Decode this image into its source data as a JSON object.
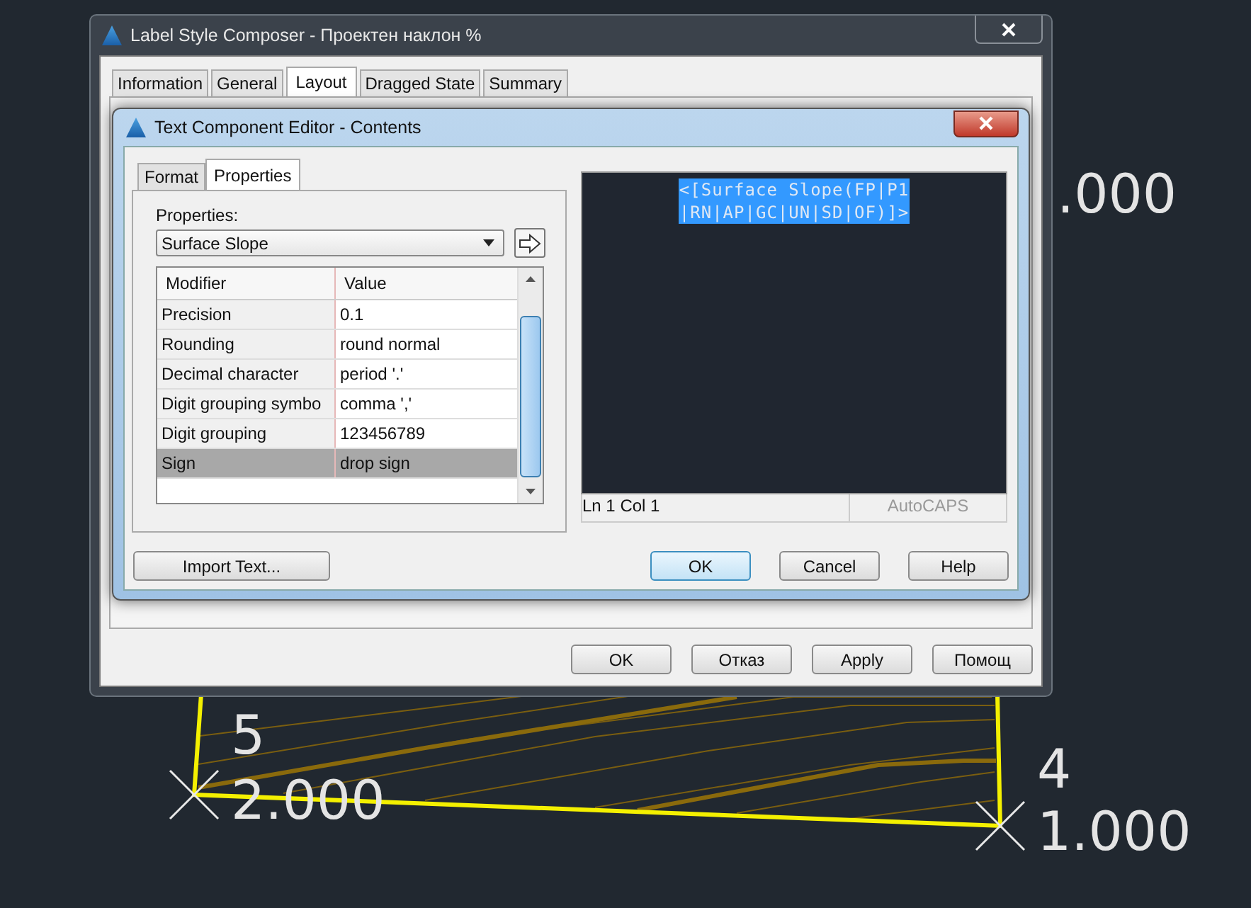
{
  "canvas": {
    "cut_label": ".000",
    "points": [
      {
        "number": "5",
        "elevation": "2.000"
      },
      {
        "number": "4",
        "elevation": "1.000"
      }
    ]
  },
  "composer": {
    "title": "Label Style Composer - Проектен наклон %",
    "tabs": [
      {
        "label": "Information",
        "selected": false
      },
      {
        "label": "General",
        "selected": false
      },
      {
        "label": "Layout",
        "selected": true
      },
      {
        "label": "Dragged State",
        "selected": false
      },
      {
        "label": "Summary",
        "selected": false
      }
    ],
    "buttons": [
      "OK",
      "Отказ",
      "Apply",
      "Помощ"
    ]
  },
  "editor": {
    "title": "Text Component Editor - Contents",
    "tabs": [
      {
        "label": "Format",
        "selected": false
      },
      {
        "label": "Properties",
        "selected": true
      }
    ],
    "properties_label": "Properties:",
    "property": "Surface Slope",
    "table": {
      "columns": [
        "Modifier",
        "Value"
      ],
      "rows": [
        {
          "modifier": "Precision",
          "value": "0.1",
          "selected": false
        },
        {
          "modifier": "Rounding",
          "value": "round normal",
          "selected": false
        },
        {
          "modifier": "Decimal character",
          "value": "period '.'",
          "selected": false
        },
        {
          "modifier": "Digit grouping symbo",
          "value": "comma ','",
          "selected": false
        },
        {
          "modifier": "Digit grouping",
          "value": "123456789",
          "selected": false
        },
        {
          "modifier": "Sign",
          "value": "drop sign",
          "selected": true
        }
      ]
    },
    "preview_lines": [
      "<[Surface Slope(FP|P1",
      "|RN|AP|GC|UN|SD|OF)]>"
    ],
    "status": [
      "Ln 1 Col 1",
      "AutoCAPS"
    ],
    "import_button": "Import Text...",
    "buttons": [
      "OK",
      "Cancel",
      "Help"
    ]
  }
}
